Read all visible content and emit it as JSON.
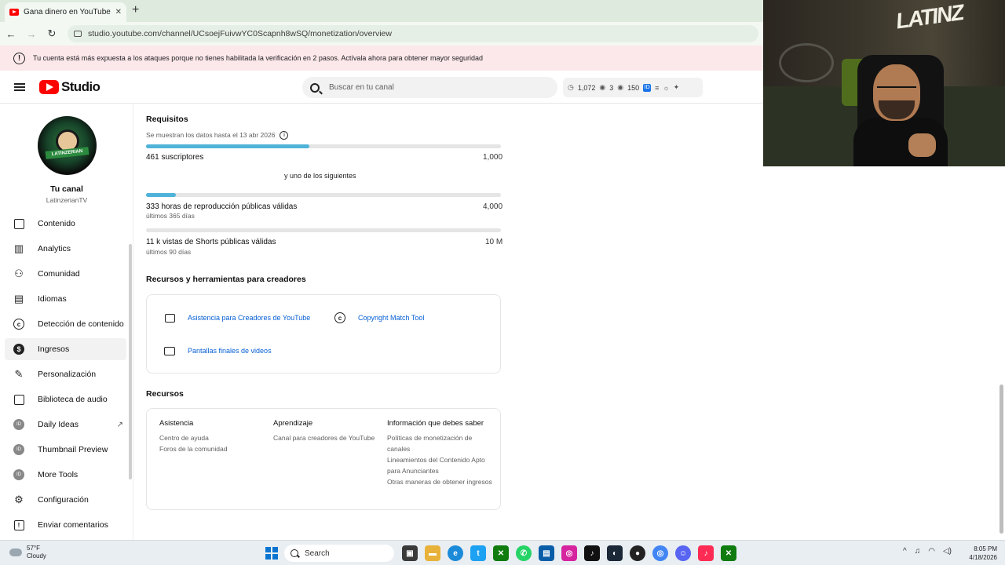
{
  "browser": {
    "tab_title": "Gana dinero en YouTube - YouTube",
    "url": "studio.youtube.com/channel/UCsoejFuivwYC0Scapnh8wSQ/monetization/overview"
  },
  "alert": {
    "text": "Tu cuenta está más expuesta a los ataques porque no tienes habilitada la verificación en 2 pasos. Actívala ahora para obtener mayor seguridad"
  },
  "header": {
    "logo_text": "Studio",
    "search_placeholder": "Buscar en tu canal",
    "stats": {
      "subs": "1,072",
      "views": "3",
      "watch": "150"
    }
  },
  "sidebar": {
    "channel_label": "Tu canal",
    "channel_name": "LatinzerianTV",
    "avatar_text": "LATINZERIAN",
    "items": [
      {
        "label": "Contenido",
        "icon": "content-icon"
      },
      {
        "label": "Analytics",
        "icon": "analytics-icon"
      },
      {
        "label": "Comunidad",
        "icon": "community-icon"
      },
      {
        "label": "Idiomas",
        "icon": "languages-icon"
      },
      {
        "label": "Detección de contenido",
        "icon": "copyright-icon"
      },
      {
        "label": "Ingresos",
        "icon": "dollar-icon"
      },
      {
        "label": "Personalización",
        "icon": "magic-wand-icon"
      },
      {
        "label": "Biblioteca de audio",
        "icon": "audio-library-icon"
      },
      {
        "label": "Daily Ideas",
        "icon": "extension-icon"
      },
      {
        "label": "Thumbnail Preview",
        "icon": "extension-icon"
      },
      {
        "label": "More Tools",
        "icon": "extension-icon"
      },
      {
        "label": "Configuración",
        "icon": "gear-icon"
      },
      {
        "label": "Enviar comentarios",
        "icon": "feedback-icon"
      }
    ]
  },
  "requirements": {
    "title": "Requisitos",
    "date_note": "Se muestran los datos hasta el 13 abr 2026",
    "subscribers": {
      "label": "461 suscriptores",
      "goal": "1,000",
      "progress": 0.461
    },
    "or_text": "y uno de los siguientes",
    "watch_hours": {
      "label": "333 horas de reproducción públicas válidas",
      "sub": "últimos 365 días",
      "goal": "4,000",
      "progress": 0.0833
    },
    "shorts_views": {
      "label": "11 k vistas de Shorts públicas válidas",
      "sub": "últimos 90 días",
      "goal": "10 M",
      "progress": 0.0011
    }
  },
  "tools": {
    "title": "Recursos y herramientas para creadores",
    "items": [
      {
        "label": "Asistencia para Creadores de YouTube",
        "icon": "chat-icon"
      },
      {
        "label": "Copyright Match Tool",
        "icon": "copyright-icon"
      },
      {
        "label": "Pantallas finales de videos",
        "icon": "end-screen-icon"
      }
    ]
  },
  "resources": {
    "title": "Recursos",
    "col1": {
      "title": "Asistencia",
      "items": [
        "Centro de ayuda",
        "Foros de la comunidad"
      ]
    },
    "col2": {
      "title": "Aprendizaje",
      "items": [
        "Canal para creadores de YouTube"
      ]
    },
    "col3": {
      "title": "Información que debes saber",
      "items": [
        "Políticas de monetización de canales",
        "Lineamientos del Contenido Apto para Anunciantes",
        "Otras maneras de obtener ingresos"
      ]
    }
  },
  "webcam": {
    "graffiti": "LATINZ"
  },
  "taskbar": {
    "weather_temp": "57°F",
    "weather_desc": "Cloudy",
    "search_label": "Search",
    "time": "8:05 PM",
    "date": "4/18/2026"
  },
  "colors": {
    "progress": "#4fb3d9",
    "link": "#065fd4",
    "alert_bg": "#fce8ea",
    "brand_red": "#ff0000"
  }
}
